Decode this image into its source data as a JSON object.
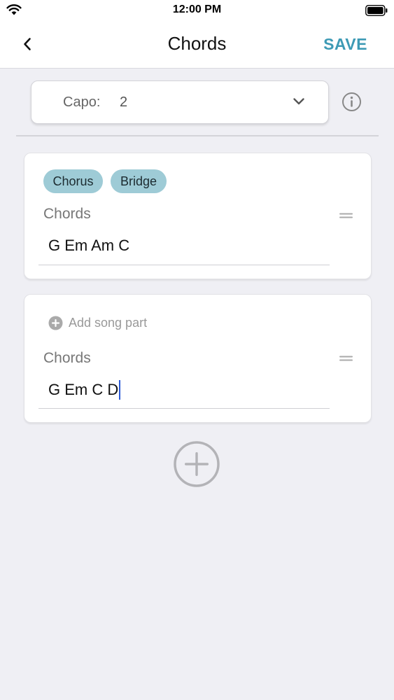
{
  "status_bar": {
    "time": "12:00 PM"
  },
  "nav": {
    "title": "Chords",
    "save_label": "SAVE"
  },
  "capo": {
    "label": "Capo:",
    "value": "2"
  },
  "parts": [
    {
      "tags": [
        "Chorus",
        "Bridge"
      ],
      "chords_label": "Chords",
      "chords_value": "G Em Am C"
    },
    {
      "add_part_label": "Add song part",
      "chords_label": "Chords",
      "chords_value": "G Em C D"
    }
  ],
  "colors": {
    "accent": "#3d9ab5",
    "tag_background": "#9ecbd6",
    "background": "#efeff4",
    "cursor": "#2d5bd6"
  },
  "icons": [
    "wifi-icon",
    "battery-icon",
    "chevron-left-icon",
    "chevron-down-icon",
    "info-icon",
    "drag-handle-icon",
    "plus-circle-icon"
  ]
}
